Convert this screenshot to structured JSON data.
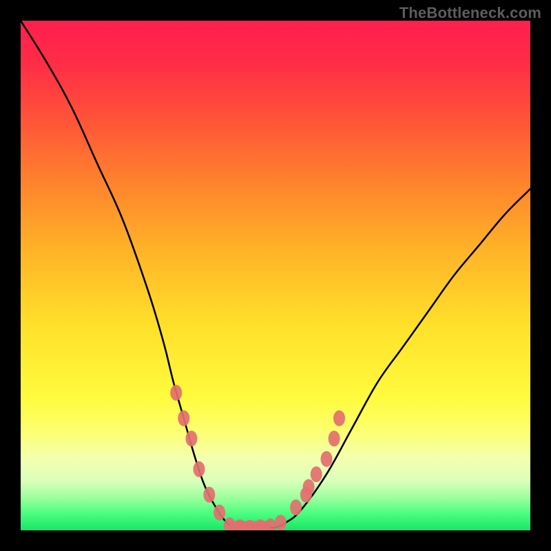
{
  "watermark": "TheBottleneck.com",
  "chart_data": {
    "type": "line",
    "title": "",
    "xlabel": "",
    "ylabel": "",
    "xlim": [
      0,
      100
    ],
    "ylim": [
      0,
      100
    ],
    "x": [
      0,
      5,
      10,
      15,
      20,
      25,
      28,
      30,
      32,
      34,
      36,
      38,
      40,
      42,
      44,
      46,
      48,
      50,
      52,
      55,
      60,
      65,
      70,
      75,
      80,
      85,
      90,
      95,
      100
    ],
    "values": [
      100,
      92,
      83,
      72,
      61,
      47,
      37,
      29,
      22,
      15,
      9,
      5,
      2,
      0.5,
      0.5,
      0.5,
      0.5,
      0.6,
      1.5,
      4,
      11,
      20,
      29,
      36,
      43,
      50,
      56,
      62,
      67
    ],
    "flat_region_x": [
      41,
      49
    ],
    "highlight_points": [
      {
        "x": 30.5,
        "y": 27
      },
      {
        "x": 32.0,
        "y": 22
      },
      {
        "x": 33.5,
        "y": 18
      },
      {
        "x": 35.0,
        "y": 12
      },
      {
        "x": 37.0,
        "y": 7
      },
      {
        "x": 39.0,
        "y": 3.5
      },
      {
        "x": 41.0,
        "y": 1
      },
      {
        "x": 43.0,
        "y": 0.6
      },
      {
        "x": 45.0,
        "y": 0.5
      },
      {
        "x": 47.0,
        "y": 0.6
      },
      {
        "x": 49.0,
        "y": 0.8
      },
      {
        "x": 51.0,
        "y": 1.5
      },
      {
        "x": 54.0,
        "y": 4.5
      },
      {
        "x": 56.0,
        "y": 7
      },
      {
        "x": 56.5,
        "y": 8.5
      },
      {
        "x": 58.0,
        "y": 11
      },
      {
        "x": 60.0,
        "y": 14
      },
      {
        "x": 61.5,
        "y": 18
      },
      {
        "x": 62.5,
        "y": 22
      }
    ],
    "gradient_stops": [
      {
        "offset": 0.0,
        "color": "#ff1f4f"
      },
      {
        "offset": 0.08,
        "color": "#ff2b47"
      },
      {
        "offset": 0.18,
        "color": "#ff4e3a"
      },
      {
        "offset": 0.3,
        "color": "#ff7c2e"
      },
      {
        "offset": 0.45,
        "color": "#ffb327"
      },
      {
        "offset": 0.6,
        "color": "#ffe12a"
      },
      {
        "offset": 0.74,
        "color": "#fffb3d"
      },
      {
        "offset": 0.8,
        "color": "#fdff6b"
      },
      {
        "offset": 0.86,
        "color": "#f4ffb0"
      },
      {
        "offset": 0.905,
        "color": "#d7ffb8"
      },
      {
        "offset": 0.935,
        "color": "#9fff9e"
      },
      {
        "offset": 0.965,
        "color": "#4eff82"
      },
      {
        "offset": 1.0,
        "color": "#17e765"
      }
    ],
    "marker_color": "#e36f6f",
    "curve_color": "#000000"
  }
}
